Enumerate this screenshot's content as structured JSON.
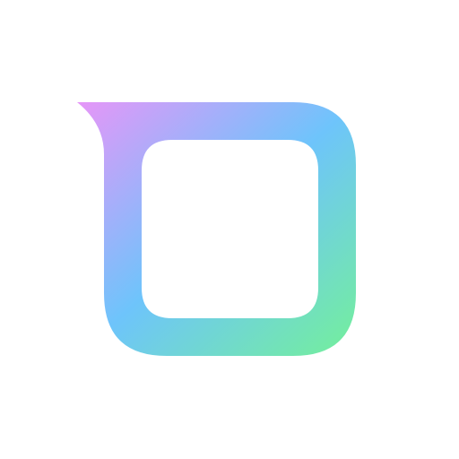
{
  "logo": {
    "icon": "speech-bubble-square-outline-icon",
    "gradient_colors": [
      "#e696f8",
      "#6ec4fb",
      "#74f09a"
    ],
    "background": "#ffffff"
  }
}
